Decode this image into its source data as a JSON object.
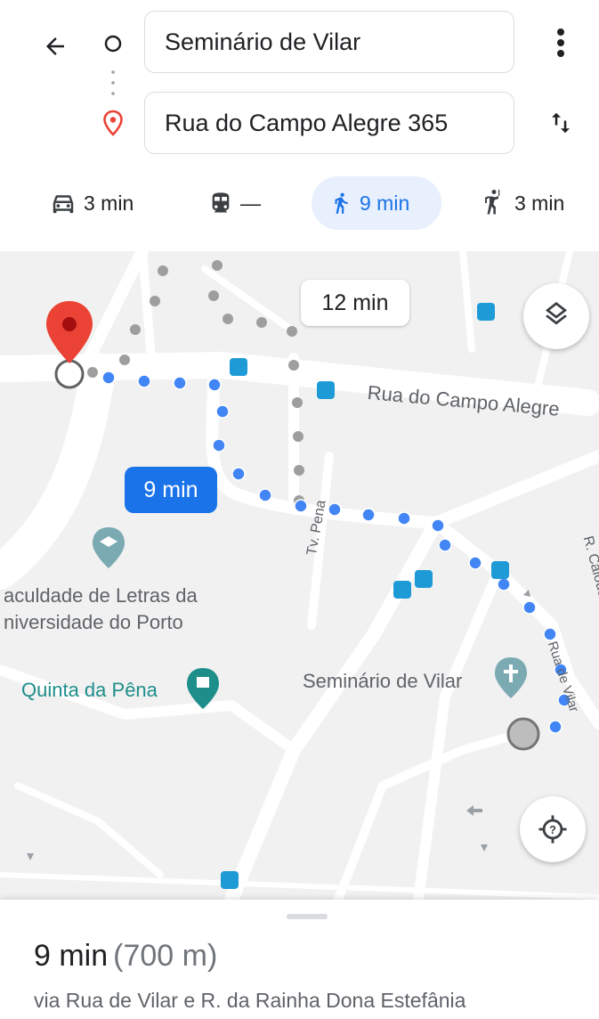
{
  "search": {
    "origin": "Seminário de Vilar",
    "destination": "Rua do Campo Alegre 365"
  },
  "modes": [
    {
      "icon": "car-icon",
      "label": "3 min"
    },
    {
      "icon": "train-icon",
      "label": "—"
    },
    {
      "icon": "walk-icon",
      "label": "9 min"
    },
    {
      "icon": "ride-hail-icon",
      "label": "3 min"
    }
  ],
  "map": {
    "callout_alt": "12 min",
    "callout_main": "9 min",
    "labels": {
      "street_main": "Rua do Campo Alegre",
      "street_pena": "Tv. Pena",
      "street_calouste": "R. Calouste Gu",
      "street_vilar": "Rua de Vilar",
      "faculty_line1": "aculdade de Letras da",
      "faculty_line2": "niversidade do Porto",
      "quinta": "Quinta da Pêna",
      "seminario": "Seminário de Vilar"
    }
  },
  "route": {
    "time": "9 min",
    "distance": "(700 m)",
    "via": "via Rua de Vilar e R. da Rainha Dona Estefânia"
  },
  "colors": {
    "accent": "#1a73e8",
    "route_dot": "#4285f4",
    "pin": "#ea4335",
    "place_teal": "#1e8e8a"
  }
}
